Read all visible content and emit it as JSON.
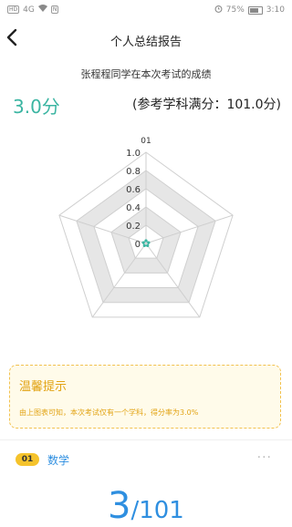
{
  "status_bar": {
    "left_badges": [
      "HD",
      "4G",
      "N"
    ],
    "battery": "75%",
    "time": "3:10"
  },
  "header": {
    "title": "个人总结报告"
  },
  "summary": {
    "subtitle": "张程程同学在本次考试的成绩",
    "score": "3.0分",
    "full_score": "(参考学科满分：101.0分)"
  },
  "chart_data": {
    "type": "radar",
    "axes": [
      "01",
      "",
      "",
      "",
      ""
    ],
    "tick_labels": [
      "1.0",
      "0.8",
      "0.6",
      "0.4",
      "0.2",
      "0"
    ],
    "range": [
      0,
      1
    ],
    "series": [
      {
        "values": [
          0.03,
          0.03,
          0.03,
          0.03,
          0.03
        ]
      }
    ],
    "colors": {
      "band_dark": "#e6e6e6",
      "band_light": "#ffffff",
      "series": "#3bb5a2"
    }
  },
  "tip": {
    "title": "温馨提示",
    "text": "由上图表可知，本次考试仅有一个学科，得分率为3.0%"
  },
  "subject": {
    "index": "01",
    "name": "数学",
    "more": "···"
  },
  "big_score": {
    "score": "3",
    "total": "/101"
  }
}
